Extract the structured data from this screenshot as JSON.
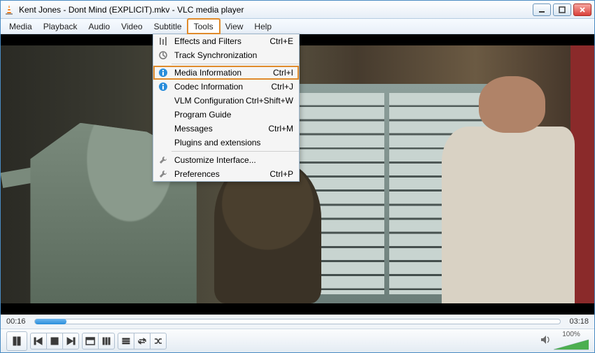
{
  "titlebar": {
    "title": "Kent Jones - Dont Mind (EXPLICIT).mkv - VLC media player"
  },
  "menubar": {
    "items": [
      "Media",
      "Playback",
      "Audio",
      "Video",
      "Subtitle",
      "Tools",
      "View",
      "Help"
    ],
    "active_index": 5
  },
  "tools_menu": {
    "items": [
      {
        "icon": "equalizer",
        "label": "Effects and Filters",
        "shortcut": "Ctrl+E"
      },
      {
        "icon": "sync",
        "label": "Track Synchronization",
        "shortcut": ""
      },
      {
        "sep": true
      },
      {
        "icon": "info",
        "label": "Media Information",
        "shortcut": "Ctrl+I",
        "highlight": true
      },
      {
        "icon": "info",
        "label": "Codec Information",
        "shortcut": "Ctrl+J"
      },
      {
        "icon": "",
        "label": "VLM Configuration",
        "shortcut": "Ctrl+Shift+W"
      },
      {
        "icon": "",
        "label": "Program Guide",
        "shortcut": ""
      },
      {
        "icon": "",
        "label": "Messages",
        "shortcut": "Ctrl+M"
      },
      {
        "icon": "",
        "label": "Plugins and extensions",
        "shortcut": ""
      },
      {
        "sep": true
      },
      {
        "icon": "wrench",
        "label": "Customize Interface...",
        "shortcut": ""
      },
      {
        "icon": "wrench",
        "label": "Preferences",
        "shortcut": "Ctrl+P"
      }
    ]
  },
  "player": {
    "current_time": "00:16",
    "total_time": "03:18",
    "progress_percent": 6,
    "volume_percent_label": "100%",
    "volume_percent": 100
  },
  "icons": {
    "minimize": "minimize",
    "maximize": "maximize",
    "close": "close"
  }
}
